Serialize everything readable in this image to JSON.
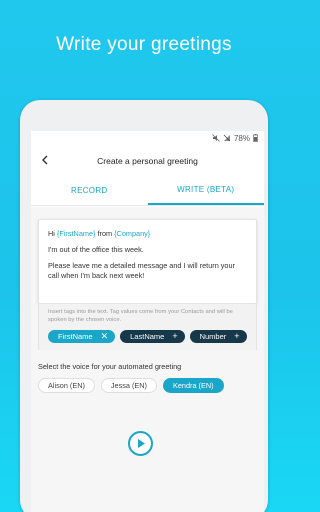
{
  "headline": "Write your greetings",
  "status": {
    "battery": "78%"
  },
  "appbar": {
    "title": "Create a personal greeting"
  },
  "tabs": [
    {
      "label": "RECORD",
      "active": false
    },
    {
      "label": "WRITE (BETA)",
      "active": true
    }
  ],
  "editor": {
    "line1_prefix": "Hi ",
    "line1_tag1": "{FirstName}",
    "line1_mid": " from ",
    "line1_tag2": "{Company}",
    "line2": "I'm out of the office this week.",
    "line3": "Please leave me a detailed message and I will return your call when I'm back next week!"
  },
  "tags": {
    "help": "Insert tags into the text. Tag values come from your Contacts and will be spoken by the chosen voice.",
    "chips": [
      {
        "label": "FirstName",
        "symbol": "✕",
        "selected": true
      },
      {
        "label": "LastName",
        "symbol": "+",
        "selected": false
      },
      {
        "label": "Number",
        "symbol": "+",
        "selected": false
      }
    ]
  },
  "voice": {
    "label": "Select the voice for your automated greeting",
    "options": [
      {
        "label": "Alison (EN)",
        "selected": false
      },
      {
        "label": "Jessa (EN)",
        "selected": false
      },
      {
        "label": "Kendra (EN)",
        "selected": true
      }
    ]
  },
  "colors": {
    "accent": "#1aa6c8",
    "dark_chip": "#16384a",
    "background": "#21c8ee"
  }
}
